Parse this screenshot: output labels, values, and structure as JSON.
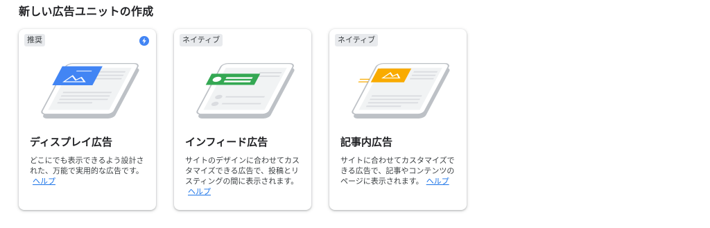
{
  "page": {
    "title": "新しい広告ユニットの作成"
  },
  "cards": [
    {
      "badge": "推奨",
      "title": "ディスプレイ広告",
      "description": "どこにでも表示できるよう設計された、万能で実用的な広告です。",
      "help": "ヘルプ",
      "accent": "#4285f4",
      "icon": "bolt-icon"
    },
    {
      "badge": "ネイティブ",
      "title": "インフィード広告",
      "description": "サイトのデザインに合わせてカスタマイズできる広告で、投稿とリスティングの間に表示されます。",
      "help": "ヘルプ",
      "accent": "#34a853"
    },
    {
      "badge": "ネイティブ",
      "title": "記事内広告",
      "description": "サイトに合わせてカスタマイズできる広告で、記事やコンテンツのページに表示されます。",
      "help": "ヘルプ",
      "accent": "#f9ab00"
    }
  ]
}
